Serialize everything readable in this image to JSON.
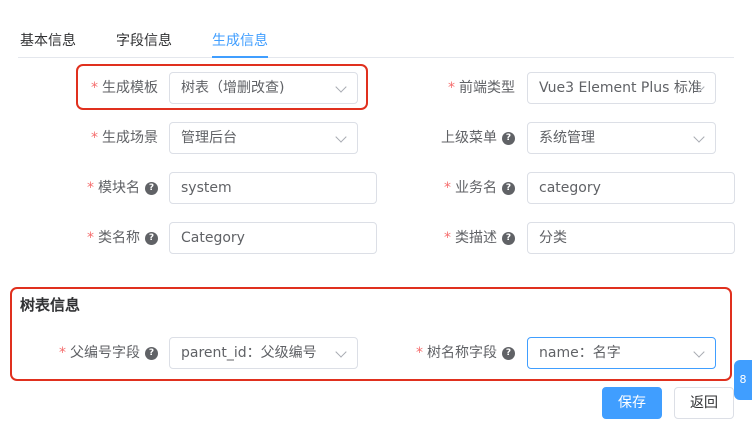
{
  "tabs": [
    {
      "label": "基本信息"
    },
    {
      "label": "字段信息"
    },
    {
      "label": "生成信息"
    }
  ],
  "form": {
    "template_label": "生成模板",
    "template_value": "树表（增删改查)",
    "frontend_label": "前端类型",
    "frontend_value": "Vue3 Element Plus 标准",
    "scene_label": "生成场景",
    "scene_value": "管理后台",
    "parent_menu_label": "上级菜单",
    "parent_menu_value": "系统管理",
    "module_label": "模块名",
    "module_value": "system",
    "business_label": "业务名",
    "business_value": "category",
    "class_label": "类名称",
    "class_value": "Category",
    "desc_label": "类描述",
    "desc_value": "分类"
  },
  "tree": {
    "section_title": "树表信息",
    "parent_field_label": "父编号字段",
    "parent_field_value": "parent_id：父级编号",
    "name_field_label": "树名称字段",
    "name_field_value": "name：名字"
  },
  "buttons": {
    "save": "保存",
    "back": "返回"
  },
  "side_tab": {
    "label": "8"
  },
  "colors": {
    "primary": "#409eff",
    "required": "#f56c6c",
    "highlight_box": "#e0301e"
  },
  "icons": {
    "help": "question-circle-icon",
    "select": "chevron-down-icon"
  }
}
